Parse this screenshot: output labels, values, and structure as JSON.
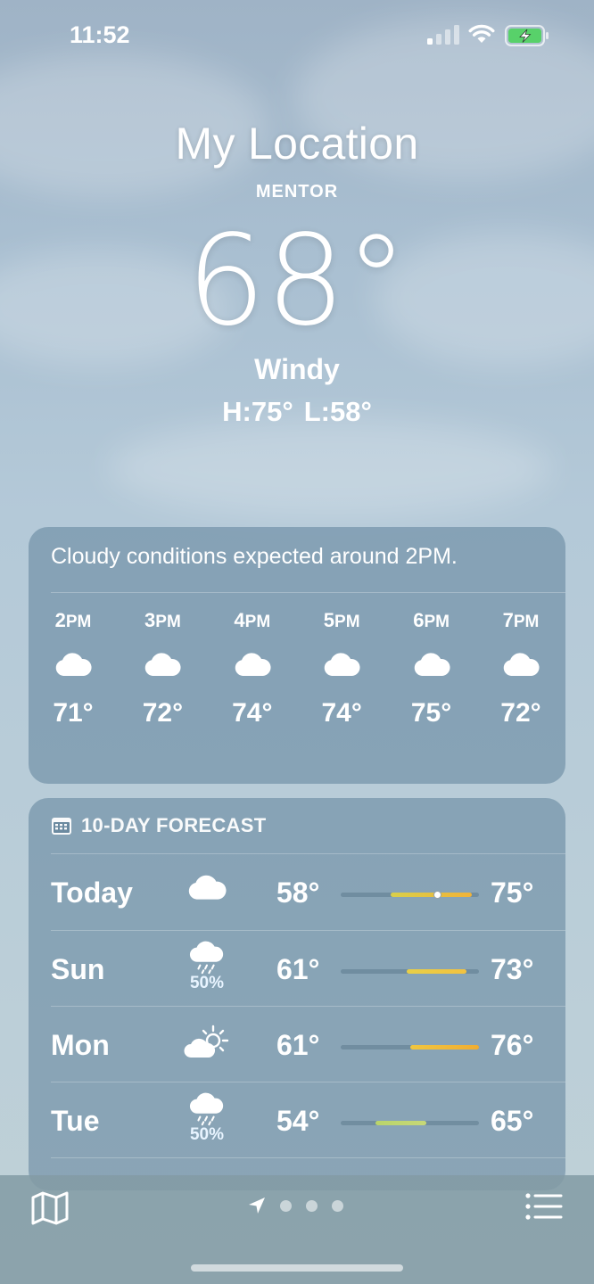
{
  "status_bar": {
    "time": "11:52"
  },
  "header": {
    "title": "My Location",
    "subtitle": "MENTOR",
    "temperature": "68°",
    "condition": "Windy",
    "high": "H:75°",
    "low": "L:58°"
  },
  "hourly": {
    "summary": "Cloudy conditions expected around 2PM.",
    "hours": [
      {
        "hour": "2",
        "suffix": "PM",
        "temp": "71°",
        "icon": "cloud-icon"
      },
      {
        "hour": "3",
        "suffix": "PM",
        "temp": "72°",
        "icon": "cloud-icon"
      },
      {
        "hour": "4",
        "suffix": "PM",
        "temp": "74°",
        "icon": "cloud-icon"
      },
      {
        "hour": "5",
        "suffix": "PM",
        "temp": "74°",
        "icon": "cloud-icon"
      },
      {
        "hour": "6",
        "suffix": "PM",
        "temp": "75°",
        "icon": "cloud-icon"
      },
      {
        "hour": "7",
        "suffix": "PM",
        "temp": "72°",
        "icon": "cloud-icon"
      }
    ]
  },
  "forecast": {
    "title": "10-DAY FORECAST",
    "days": [
      {
        "day": "Today",
        "icon": "cloud-icon",
        "precip": "",
        "low": "58°",
        "high": "75°",
        "bar_start": 0.36,
        "bar_end": 0.95,
        "current": 0.7,
        "color_start": "#d9cf4a",
        "color_end": "#f1b338"
      },
      {
        "day": "Sun",
        "icon": "cloud-rain-icon",
        "precip": "50%",
        "low": "61°",
        "high": "73°",
        "bar_start": 0.48,
        "bar_end": 0.91,
        "color_start": "#e8cf47",
        "color_end": "#f2c240"
      },
      {
        "day": "Mon",
        "icon": "sun-cloud-icon",
        "precip": "",
        "low": "61°",
        "high": "76°",
        "bar_start": 0.5,
        "bar_end": 1.0,
        "color_start": "#f0c640",
        "color_end": "#f0ad32"
      },
      {
        "day": "Tue",
        "icon": "cloud-rain-icon",
        "precip": "50%",
        "low": "54°",
        "high": "65°",
        "bar_start": 0.25,
        "bar_end": 0.62,
        "color_start": "#b9d46a",
        "color_end": "#c7d878"
      }
    ]
  }
}
